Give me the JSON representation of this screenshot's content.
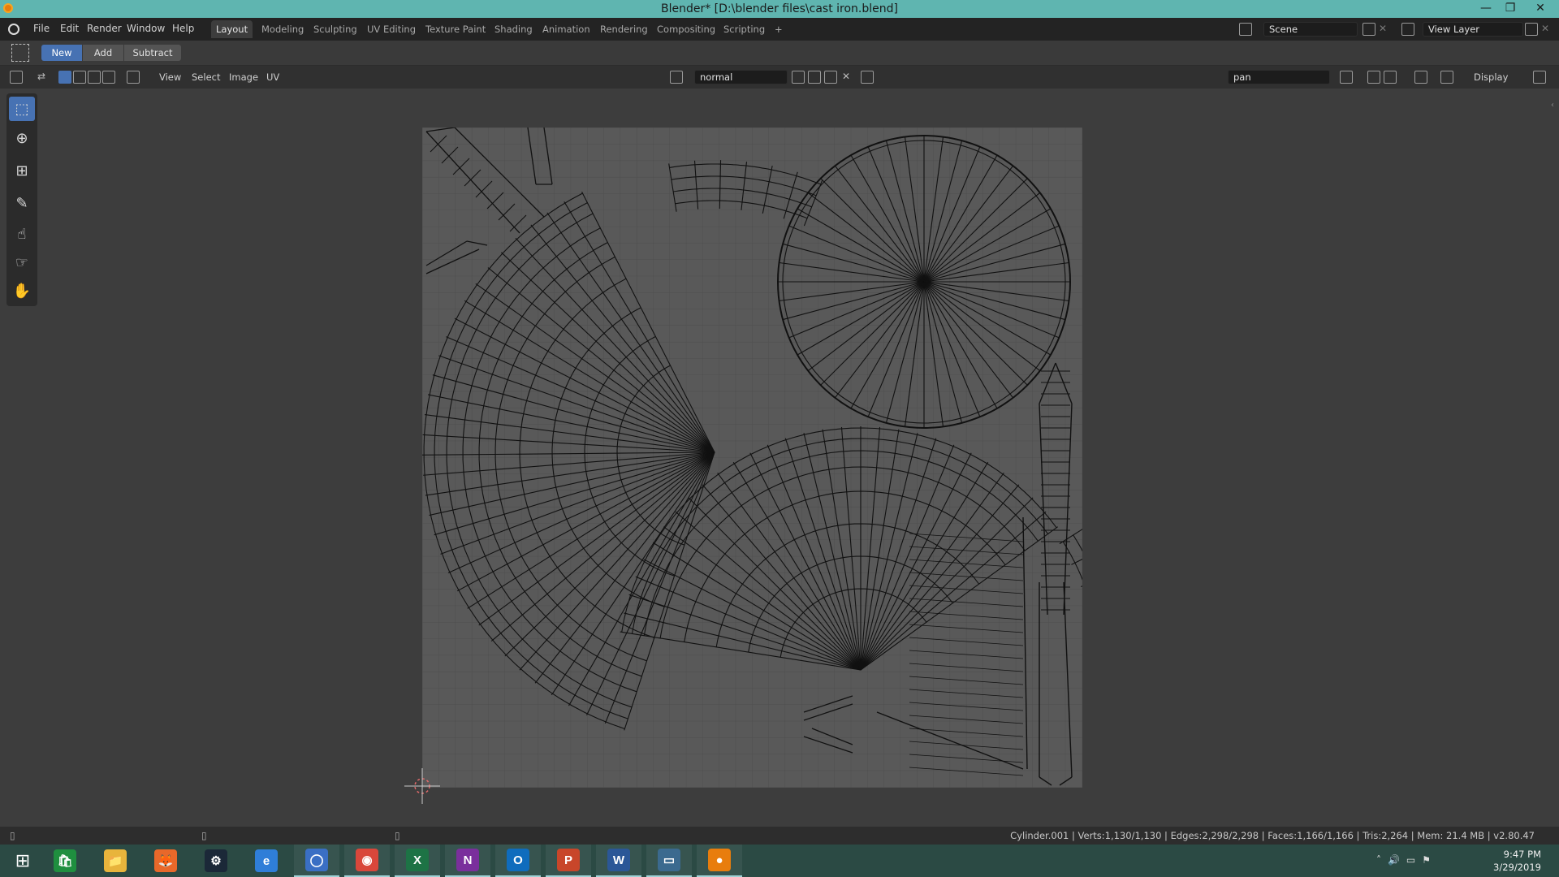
{
  "window": {
    "title": "Blender* [D:\\blender files\\cast iron.blend]",
    "controls": [
      "—",
      "❐",
      "✕"
    ]
  },
  "menu": [
    "File",
    "Edit",
    "Render",
    "Window",
    "Help"
  ],
  "workspaces": [
    "Layout",
    "Modeling",
    "Sculpting",
    "UV Editing",
    "Texture Paint",
    "Shading",
    "Animation",
    "Rendering",
    "Compositing",
    "Scripting",
    "+"
  ],
  "active_workspace": "Layout",
  "scene": {
    "name": "Scene"
  },
  "view_layer": {
    "name": "View Layer"
  },
  "select_mode": {
    "new": "New",
    "add": "Add",
    "subtract": "Subtract",
    "active": "New"
  },
  "editor_menu": [
    "View",
    "Select",
    "Image",
    "UV"
  ],
  "image_name": "normal",
  "uv_map_name": "pan",
  "display_label": "Display",
  "status": "Cylinder.001 | Verts:1,130/1,130 | Edges:2,298/2,298 | Faces:1,166/1,166 | Tris:2,264 | Mem: 21.4 MB | v2.80.47",
  "taskbar": {
    "apps": [
      {
        "name": "store",
        "glyph": "🛍",
        "color": "#1f8f3f"
      },
      {
        "name": "file-explorer",
        "glyph": "📁",
        "color": "#e8b43c"
      },
      {
        "name": "firefox",
        "glyph": "🦊",
        "color": "#e8682a"
      },
      {
        "name": "steam",
        "glyph": "⚙",
        "color": "#1b2838"
      },
      {
        "name": "edge",
        "glyph": "e",
        "color": "#2f7ed8"
      },
      {
        "name": "cortana-browser",
        "glyph": "◯",
        "color": "#3a6fc4"
      },
      {
        "name": "chrome",
        "glyph": "◉",
        "color": "#d9473b"
      },
      {
        "name": "excel",
        "glyph": "X",
        "color": "#1d7345"
      },
      {
        "name": "onenote",
        "glyph": "N",
        "color": "#7a2f9c"
      },
      {
        "name": "outlook",
        "glyph": "O",
        "color": "#0f6cbd"
      },
      {
        "name": "powerpoint",
        "glyph": "P",
        "color": "#c8462a"
      },
      {
        "name": "word",
        "glyph": "W",
        "color": "#2b5797"
      },
      {
        "name": "desktop-window",
        "glyph": "▭",
        "color": "#3b6a8f"
      },
      {
        "name": "blender",
        "glyph": "●",
        "color": "#e87d0d"
      }
    ],
    "time": "9:47 PM",
    "date": "3/29/2019"
  }
}
